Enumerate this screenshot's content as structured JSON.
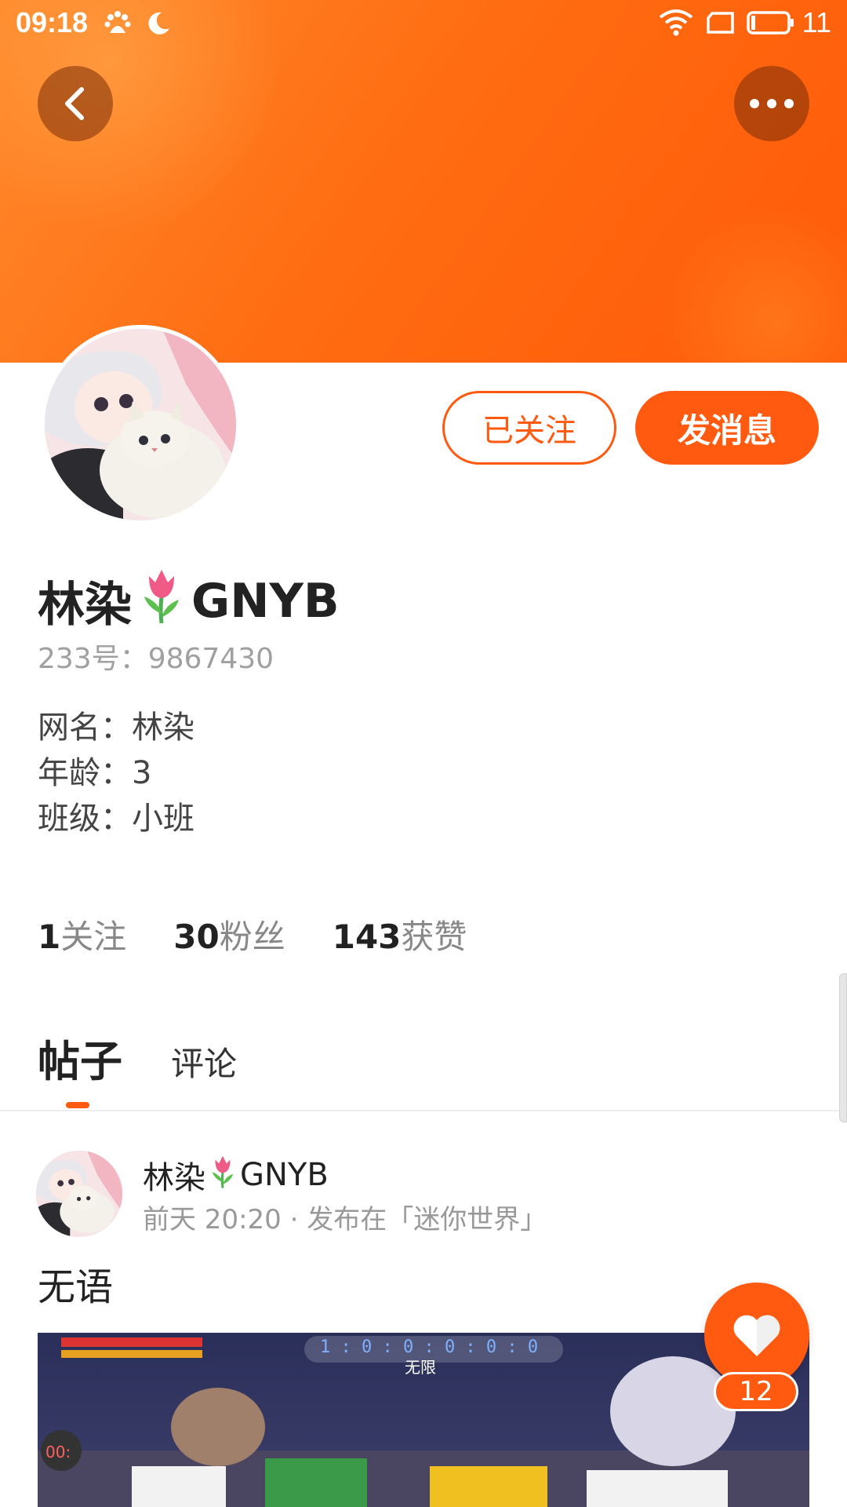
{
  "status_bar": {
    "time": "09:18",
    "battery": "11"
  },
  "colors": {
    "brand_orange": "#ff5a10",
    "banner_start": "#ff8a2c",
    "banner_end": "#ff5a08"
  },
  "profile": {
    "name": "林染",
    "name_suffix": "GNYB",
    "emoji": "tulip",
    "id_line": "233号：9867430",
    "bio": [
      "网名：林染",
      "年龄：3",
      "班级：小班"
    ],
    "followed_label": "已关注",
    "message_label": "发消息"
  },
  "stats": [
    {
      "value": "1",
      "label": "关注"
    },
    {
      "value": "30",
      "label": "粉丝"
    },
    {
      "value": "143",
      "label": "获赞"
    }
  ],
  "tabs": [
    {
      "label": "帖子",
      "active": true
    },
    {
      "label": "评论",
      "active": false
    }
  ],
  "post": {
    "author": "林染",
    "author_suffix": "GNYB",
    "meta": "前天 20:20 · 发布在「迷你世界」",
    "text": "无语",
    "image_overlay": {
      "score": "1 : 0 : 0 : 0 : 0 : 0",
      "mode": "无限",
      "timer": "00:"
    }
  },
  "like": {
    "count": "12"
  }
}
